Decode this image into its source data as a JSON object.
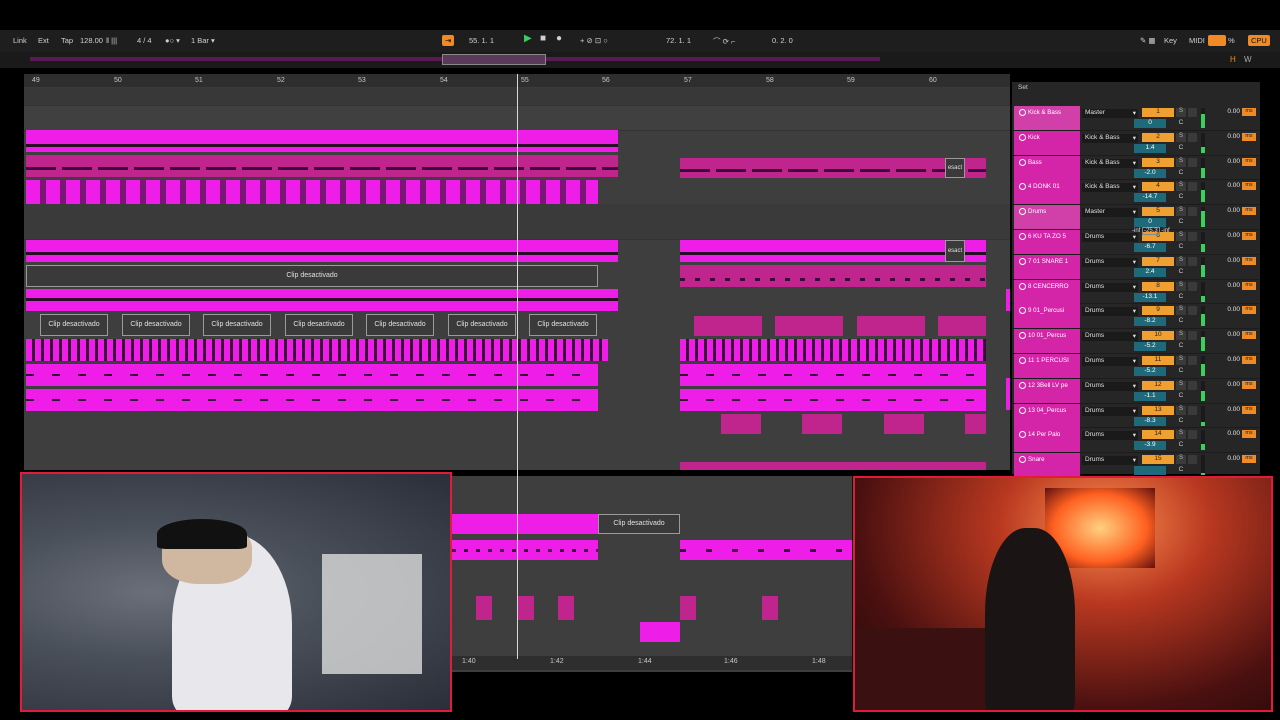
{
  "control_bar": {
    "link": "Link",
    "ext": "Ext",
    "tap": "Tap",
    "tempo": "128.00",
    "time_signature": "4 / 4",
    "quantize": "1 Bar",
    "position": "55.  1.  1",
    "loop_start": "72.  1.  1",
    "loop_length": "0.  2.  0",
    "key": "Key",
    "midi": "MIDI",
    "cpu_pct": "%",
    "cpu": "CPU"
  },
  "ruler": {
    "bars": [
      "49",
      "50",
      "51",
      "52",
      "53",
      "54",
      "55",
      "56",
      "57",
      "58",
      "59",
      "60"
    ]
  },
  "clip_labels": {
    "deactivated": "Clip desactivado",
    "short": "esact"
  },
  "mixer": {
    "set_label": "Set",
    "tracks": [
      {
        "name": "Kick & Bass",
        "out": "Master",
        "num": "1",
        "vol": "0",
        "db": "0.00",
        "ms": "ms"
      },
      {
        "name": "Kick",
        "out": "Kick & Bass",
        "num": "2",
        "vol": "1.4",
        "db": "0.00",
        "ms": "ms"
      },
      {
        "name": "Bass",
        "out": "Kick & Bass",
        "num": "3",
        "vol": "-2.0",
        "db": "0.00",
        "ms": "ms"
      },
      {
        "name": "4 DONK 01",
        "out": "Kick & Bass",
        "num": "4",
        "vol": "-14.7",
        "db": "0.00",
        "ms": "ms"
      },
      {
        "name": "Drums",
        "out": "Master",
        "num": "5",
        "vol": "0",
        "db": "0.00",
        "ms": "ms"
      },
      {
        "name": "6 KU TA ZO 5",
        "out": "Drums",
        "num": "6",
        "vol": "-6.7",
        "db": "0.00",
        "ms": "ms"
      },
      {
        "name": "7 01 SNARE 1",
        "out": "Drums",
        "num": "7",
        "vol": "2.4",
        "db": "0.00",
        "ms": "ms"
      },
      {
        "name": "8 CENCERRO",
        "out": "Drums",
        "num": "8",
        "vol": "-13.1",
        "db": "0.00",
        "ms": "ms"
      },
      {
        "name": "9 01_Percusi",
        "out": "Drums",
        "num": "9",
        "vol": "-8.2",
        "db": "0.00",
        "ms": "ms"
      },
      {
        "name": "10 01_Percus",
        "out": "Drums",
        "num": "10",
        "vol": "-5.2",
        "db": "0.00",
        "ms": "ms"
      },
      {
        "name": "11 1 PERCUSI",
        "out": "Drums",
        "num": "11",
        "vol": "-5.2",
        "db": "0.00",
        "ms": "ms"
      },
      {
        "name": "12 3Bell LV pe",
        "out": "Drums",
        "num": "12",
        "vol": "-1.1",
        "db": "0.00",
        "ms": "ms"
      },
      {
        "name": "13 04_Percus",
        "out": "Drums",
        "num": "13",
        "vol": "-8.3",
        "db": "0.00",
        "ms": "ms"
      },
      {
        "name": "14 Per Palo",
        "out": "Drums",
        "num": "14",
        "vol": "-3.9",
        "db": "0.00",
        "ms": "ms"
      },
      {
        "name": "Snare",
        "out": "Drums",
        "num": "15",
        "vol": "",
        "db": "0.00",
        "ms": "ms"
      }
    ],
    "drums_meter": [
      "-inf",
      "-25.3",
      "-inf"
    ]
  },
  "lower_timeline": [
    "1:40",
    "1:42",
    "1:44",
    "1:46",
    "1:48"
  ],
  "colors": {
    "clip_pink": "#ee1ee8",
    "track_pink": "#d424a8",
    "accent_orange": "#f08a24",
    "cam_border": "#e21a3c"
  }
}
